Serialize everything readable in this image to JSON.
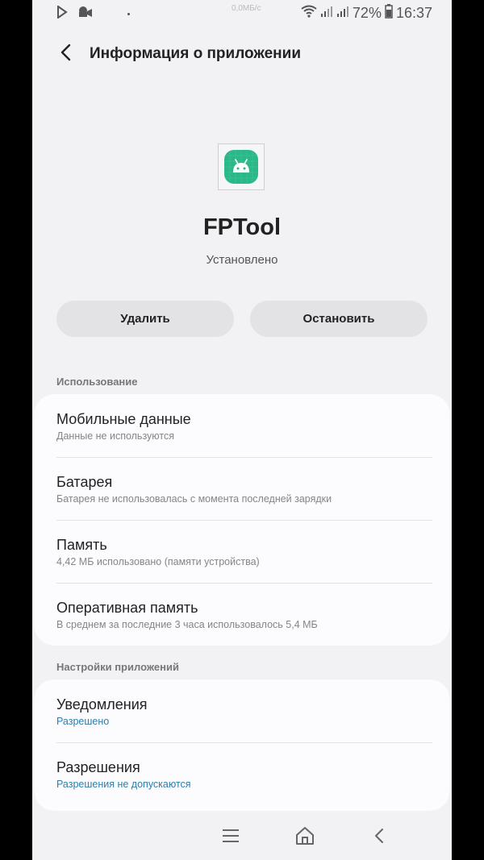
{
  "status_bar": {
    "net_speed": "0,0МБ/с",
    "battery_percent": "72%",
    "time": "16:37"
  },
  "header": {
    "title": "Информация о приложении"
  },
  "app": {
    "name": "FPTool",
    "status": "Установлено",
    "icon": "android-robot-icon",
    "icon_color": "#2bb889"
  },
  "actions": {
    "uninstall_label": "Удалить",
    "stop_label": "Остановить"
  },
  "usage_section": {
    "header": "Использование",
    "items": [
      {
        "title": "Мобильные данные",
        "subtitle": "Данные не используются"
      },
      {
        "title": "Батарея",
        "subtitle": "Батарея не использовалась с момента последней зарядки"
      },
      {
        "title": "Память",
        "subtitle": "4,42 МБ использовано (памяти устройства)"
      },
      {
        "title": "Оперативная память",
        "subtitle": "В среднем за последние 3 часа использовалось 5,4 МБ"
      }
    ]
  },
  "settings_section": {
    "header": "Настройки приложений",
    "items": [
      {
        "title": "Уведомления",
        "subtitle": "Разрешено"
      },
      {
        "title": "Разрешения",
        "subtitle": "Разрешения не допускаются"
      }
    ]
  },
  "colors": {
    "background": "#f2f2f4",
    "card": "#fcfcfe",
    "accent_text": "#2a7fae"
  }
}
